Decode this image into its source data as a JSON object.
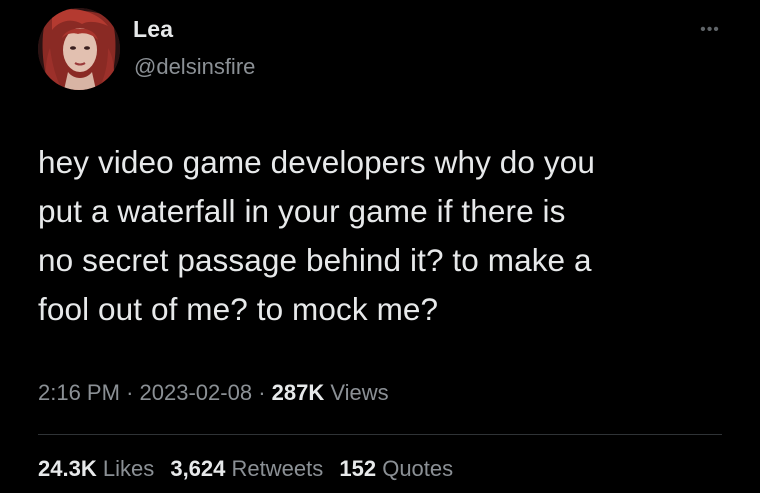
{
  "author": {
    "name": "Lea",
    "handle": "@delsinsfire",
    "avatar_icon": "profile-photo"
  },
  "menu_icon": "more-options-icon",
  "tweet": {
    "lines": [
      "hey video game developers why do you",
      "put a waterfall in your game if there is",
      "no secret passage behind it? to make a",
      "fool out of me? to mock me?"
    ]
  },
  "meta": {
    "time": "2:16 PM",
    "separator": "·",
    "date": "2023-02-08",
    "views_count": "287K",
    "views_label": "Views"
  },
  "stats": {
    "likes_count": "24.3K",
    "likes_label": "Likes",
    "retweets_count": "3,624",
    "retweets_label": "Retweets",
    "quotes_count": "152",
    "quotes_label": "Quotes"
  },
  "colors": {
    "background": "#000000",
    "primary_text": "#e7e9ea",
    "secondary_text": "#8b9095",
    "divider": "#2f3336"
  }
}
